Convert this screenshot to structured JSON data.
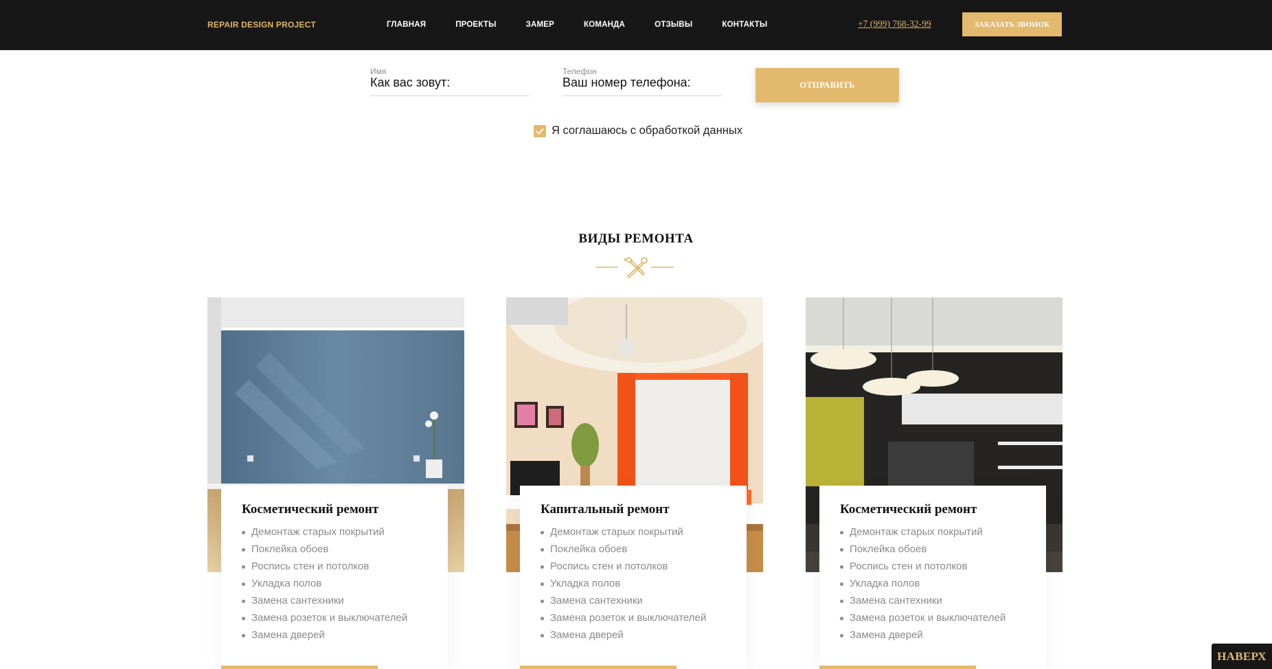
{
  "header": {
    "logo": "REPAIR DESIGN PROJECT",
    "nav": [
      "ГЛАВНАЯ",
      "ПРОЕКТЫ",
      "ЗАМЕР",
      "КОМАНДА",
      "ОТЗЫВЫ",
      "КОНТАКТЫ"
    ],
    "phone": "+7 (999) 768-32-99",
    "call_button": "ЗАКАЗАТЬ ЗВОНОК"
  },
  "form": {
    "name_label": "Имя",
    "name_placeholder": "Как вас зовут:",
    "phone_label": "Телефон",
    "phone_placeholder": "Ваш номер телефона:",
    "submit": "ОТПРАВИТЬ",
    "consent": "Я соглашаюсь с обработкой данных",
    "consent_checked": true
  },
  "section": {
    "title": "ВИДЫ РЕМОНТА",
    "divider_icon": "hammer-wrench-icon"
  },
  "cards": [
    {
      "title": "Косметический ремонт",
      "items": [
        "Демонтаж старых покрытий",
        "Поклейка обоев",
        "Роспись стен и потолков",
        "Укладка полов",
        "Замена сантехники",
        "Замена розеток и выключателей",
        "Замена дверей"
      ]
    },
    {
      "title": "Капитальный ремонт",
      "items": [
        "Демонтаж старых покрытий",
        "Поклейка обоев",
        "Роспись стен и потолков",
        "Укладка полов",
        "Замена сантехники",
        "Замена розеток и выключателей",
        "Замена дверей"
      ]
    },
    {
      "title": "Косметический ремонт",
      "items": [
        "Демонтаж старых покрытий",
        "Поклейка обоев",
        "Роспись стен и потолков",
        "Укладка полов",
        "Замена сантехники",
        "Замена розеток и выключателей",
        "Замена дверей"
      ]
    }
  ],
  "to_top": "НАВЕРХ",
  "colors": {
    "accent": "#e3b96e",
    "dark": "#171717"
  }
}
